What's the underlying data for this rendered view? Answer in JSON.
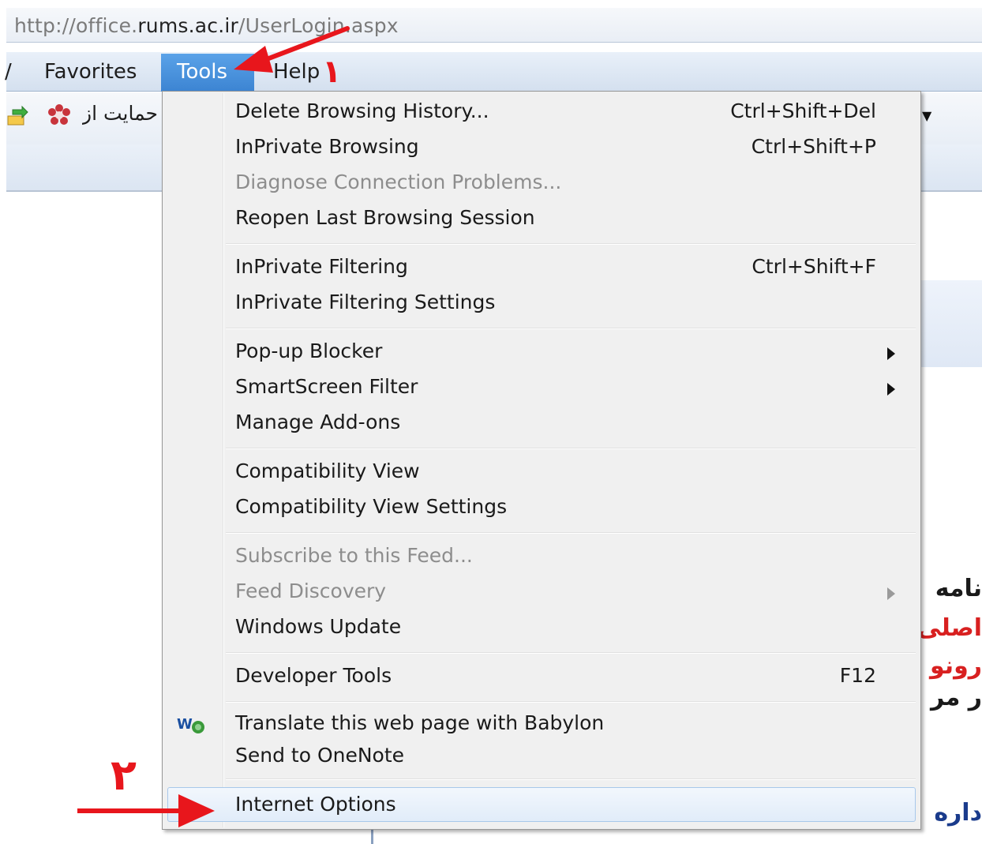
{
  "address_bar": {
    "url_prefix": "http://office.",
    "url_host": "rums.ac.ir",
    "url_suffix": "/UserLogin.aspx"
  },
  "menu_bar": {
    "left_cut": "/",
    "favorites": "Favorites",
    "tools": "Tools",
    "help": "Help"
  },
  "toolbar": {
    "favorite_link": "حمایت از"
  },
  "tools_menu": {
    "groups": [
      [
        {
          "label": "Delete Browsing History...",
          "shortcut": "Ctrl+Shift+Del",
          "disabled": false
        },
        {
          "label": "InPrivate Browsing",
          "shortcut": "Ctrl+Shift+P",
          "disabled": false
        },
        {
          "label": "Diagnose Connection Problems...",
          "shortcut": "",
          "disabled": true
        },
        {
          "label": "Reopen Last Browsing Session",
          "shortcut": "",
          "disabled": false
        }
      ],
      [
        {
          "label": "InPrivate Filtering",
          "shortcut": "Ctrl+Shift+F",
          "disabled": false
        },
        {
          "label": "InPrivate Filtering Settings",
          "shortcut": "",
          "disabled": false
        }
      ],
      [
        {
          "label": "Pop-up Blocker",
          "submenu": true,
          "disabled": false
        },
        {
          "label": "SmartScreen Filter",
          "submenu": true,
          "disabled": false
        },
        {
          "label": "Manage Add-ons",
          "disabled": false
        }
      ],
      [
        {
          "label": "Compatibility View",
          "disabled": false
        },
        {
          "label": "Compatibility View Settings",
          "disabled": false
        }
      ],
      [
        {
          "label": "Subscribe to this Feed...",
          "disabled": true
        },
        {
          "label": "Feed Discovery",
          "submenu": true,
          "disabled": true
        },
        {
          "label": "Windows Update",
          "disabled": false
        }
      ],
      [
        {
          "label": "Developer Tools",
          "shortcut": "F12",
          "disabled": false
        }
      ],
      [
        {
          "label": "Translate this web page with Babylon",
          "icon": "babylon-icon",
          "disabled": false
        },
        {
          "label": "Send to OneNote",
          "disabled": false
        }
      ],
      [
        {
          "label": "Internet Options",
          "highlighted": true,
          "disabled": false
        }
      ]
    ]
  },
  "page_text_right": {
    "line1": "نامه",
    "line2": "اصلی",
    "line3": "رونو",
    "line4": "ر مر",
    "line5": "داره"
  },
  "annotations": {
    "step1_label": "۱",
    "step2_label": "۲",
    "arrow_color": "#e8161c"
  }
}
